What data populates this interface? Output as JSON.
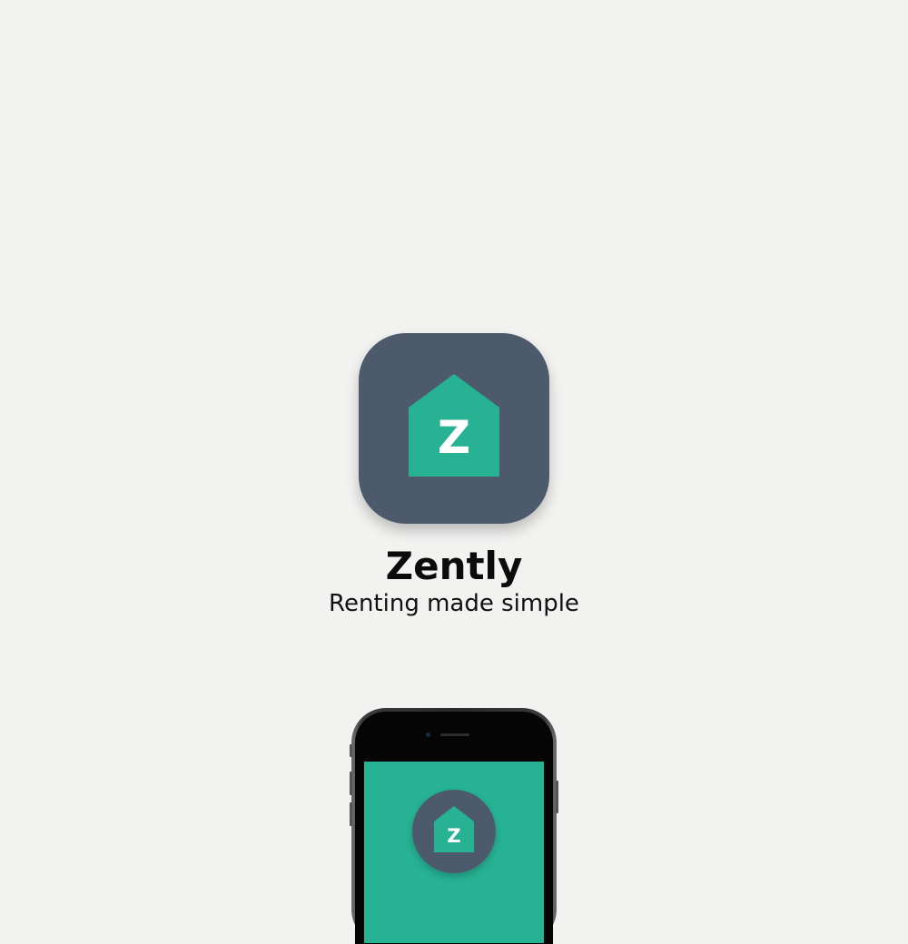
{
  "brand": {
    "name": "Zently",
    "tagline": "Renting made simple",
    "icon_letter": "Z"
  },
  "colors": {
    "background": "#f2f2f1",
    "icon_background": "#4d5a6b",
    "accent_green": "#27b294",
    "text": "#0b0b0b"
  },
  "icons": {
    "app_icon": "house-icon",
    "phone_logo": "house-icon"
  }
}
